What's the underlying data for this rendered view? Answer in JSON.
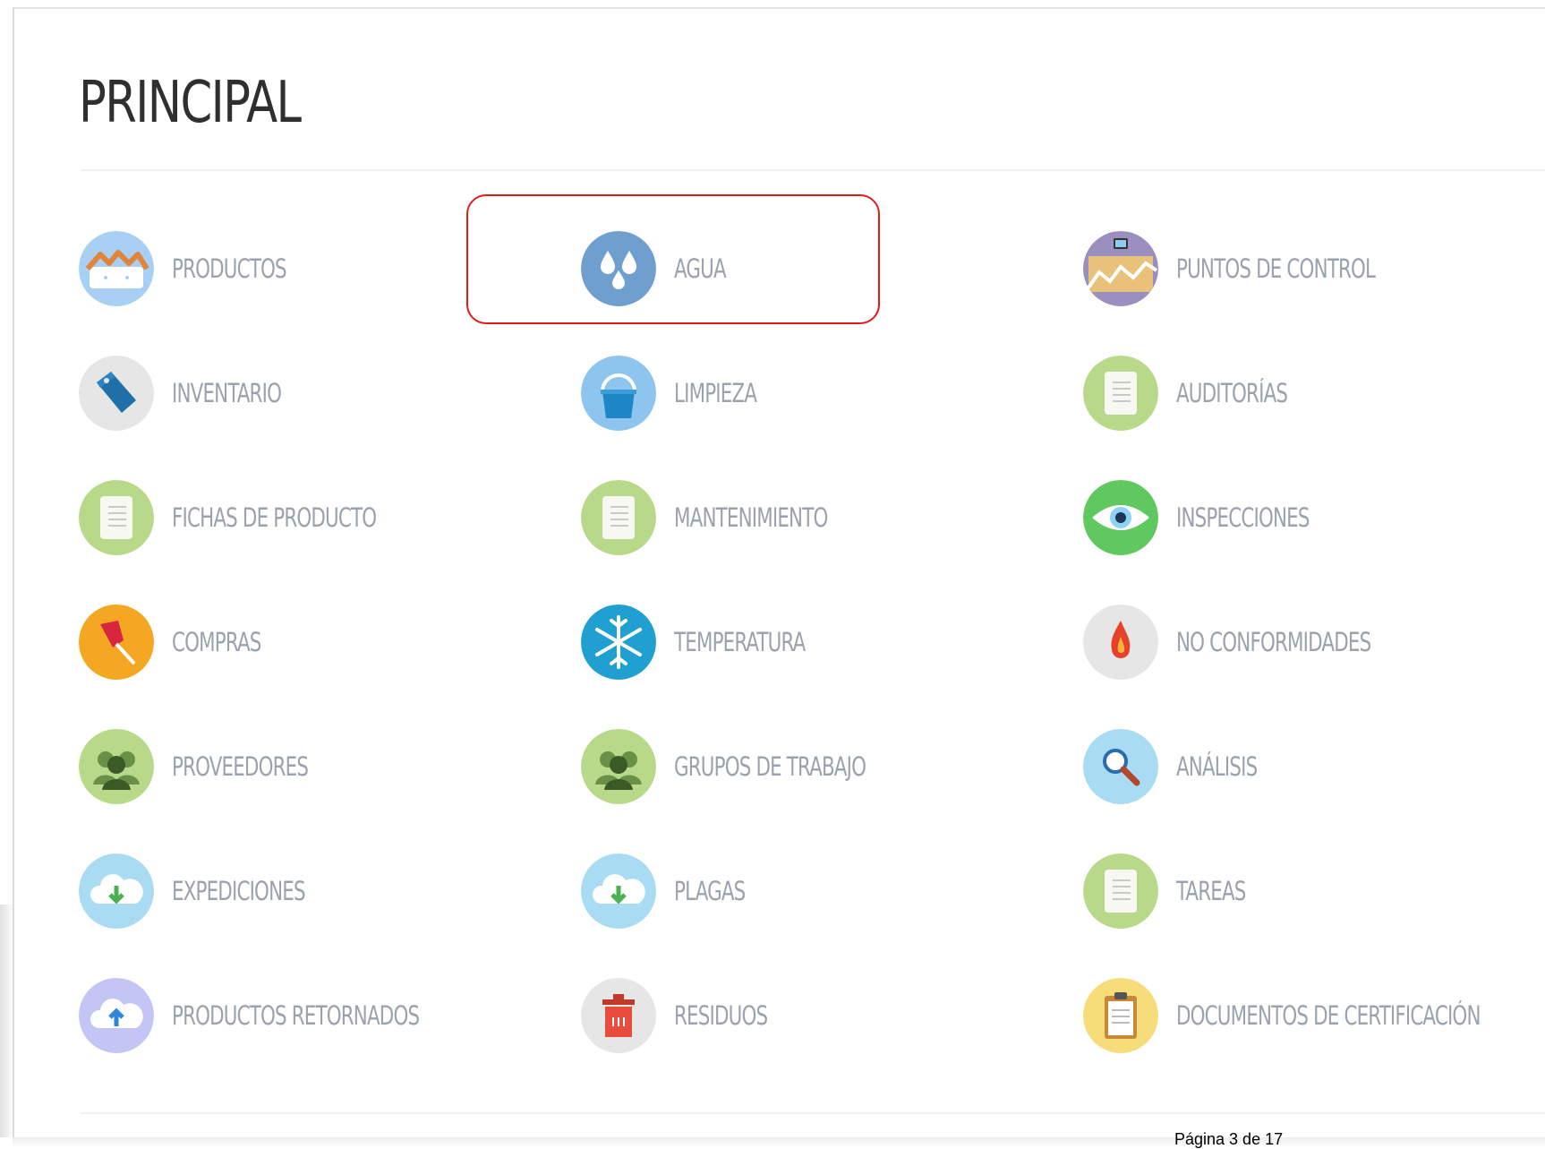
{
  "page": {
    "title": "PRINCIPAL",
    "footer": "Página 3 de 17"
  },
  "highlight": {
    "target": "AGUA",
    "color": "#e01b1b"
  },
  "menu": {
    "col1": [
      {
        "label": "PRODUCTOS",
        "icon": "house-icon"
      },
      {
        "label": "INVENTARIO",
        "icon": "tag-icon"
      },
      {
        "label": "FICHAS DE PRODUCTO",
        "icon": "document-icon"
      },
      {
        "label": "COMPRAS",
        "icon": "pushpin-icon"
      },
      {
        "label": "PROVEEDORES",
        "icon": "people-icon"
      },
      {
        "label": "EXPEDICIONES",
        "icon": "cloud-download-icon"
      },
      {
        "label": "PRODUCTOS RETORNADOS",
        "icon": "cloud-upload-icon"
      }
    ],
    "col2": [
      {
        "label": "AGUA",
        "icon": "water-drops-icon"
      },
      {
        "label": "LIMPIEZA",
        "icon": "bucket-icon"
      },
      {
        "label": "MANTENIMIENTO",
        "icon": "document-icon"
      },
      {
        "label": "TEMPERATURA",
        "icon": "snowflake-icon"
      },
      {
        "label": "GRUPOS DE TRABAJO",
        "icon": "people-icon"
      },
      {
        "label": "PLAGAS",
        "icon": "cloud-download-icon"
      },
      {
        "label": "RESIDUOS",
        "icon": "trash-bin-icon"
      }
    ],
    "col3": [
      {
        "label": "PUNTOS DE CONTROL",
        "icon": "control-chart-icon"
      },
      {
        "label": "AUDITORÍAS",
        "icon": "document-icon"
      },
      {
        "label": "INSPECCIONES",
        "icon": "eye-icon"
      },
      {
        "label": "NO CONFORMIDADES",
        "icon": "flame-icon"
      },
      {
        "label": "ANÁLISIS",
        "icon": "magnifier-icon"
      },
      {
        "label": "TAREAS",
        "icon": "document-icon"
      },
      {
        "label": "DOCUMENTOS DE CERTIFICACIÓN",
        "icon": "clipboard-icon"
      }
    ]
  },
  "colors": {
    "title": "#2f2f2f",
    "label": "#9aa3ad",
    "green_circle": "#b9d98a",
    "blue_circle": "#6f9fcf",
    "light_blue_circle": "#a9dcf2",
    "orange_circle": "#f5a623",
    "grey_circle": "#e6e6e6"
  }
}
